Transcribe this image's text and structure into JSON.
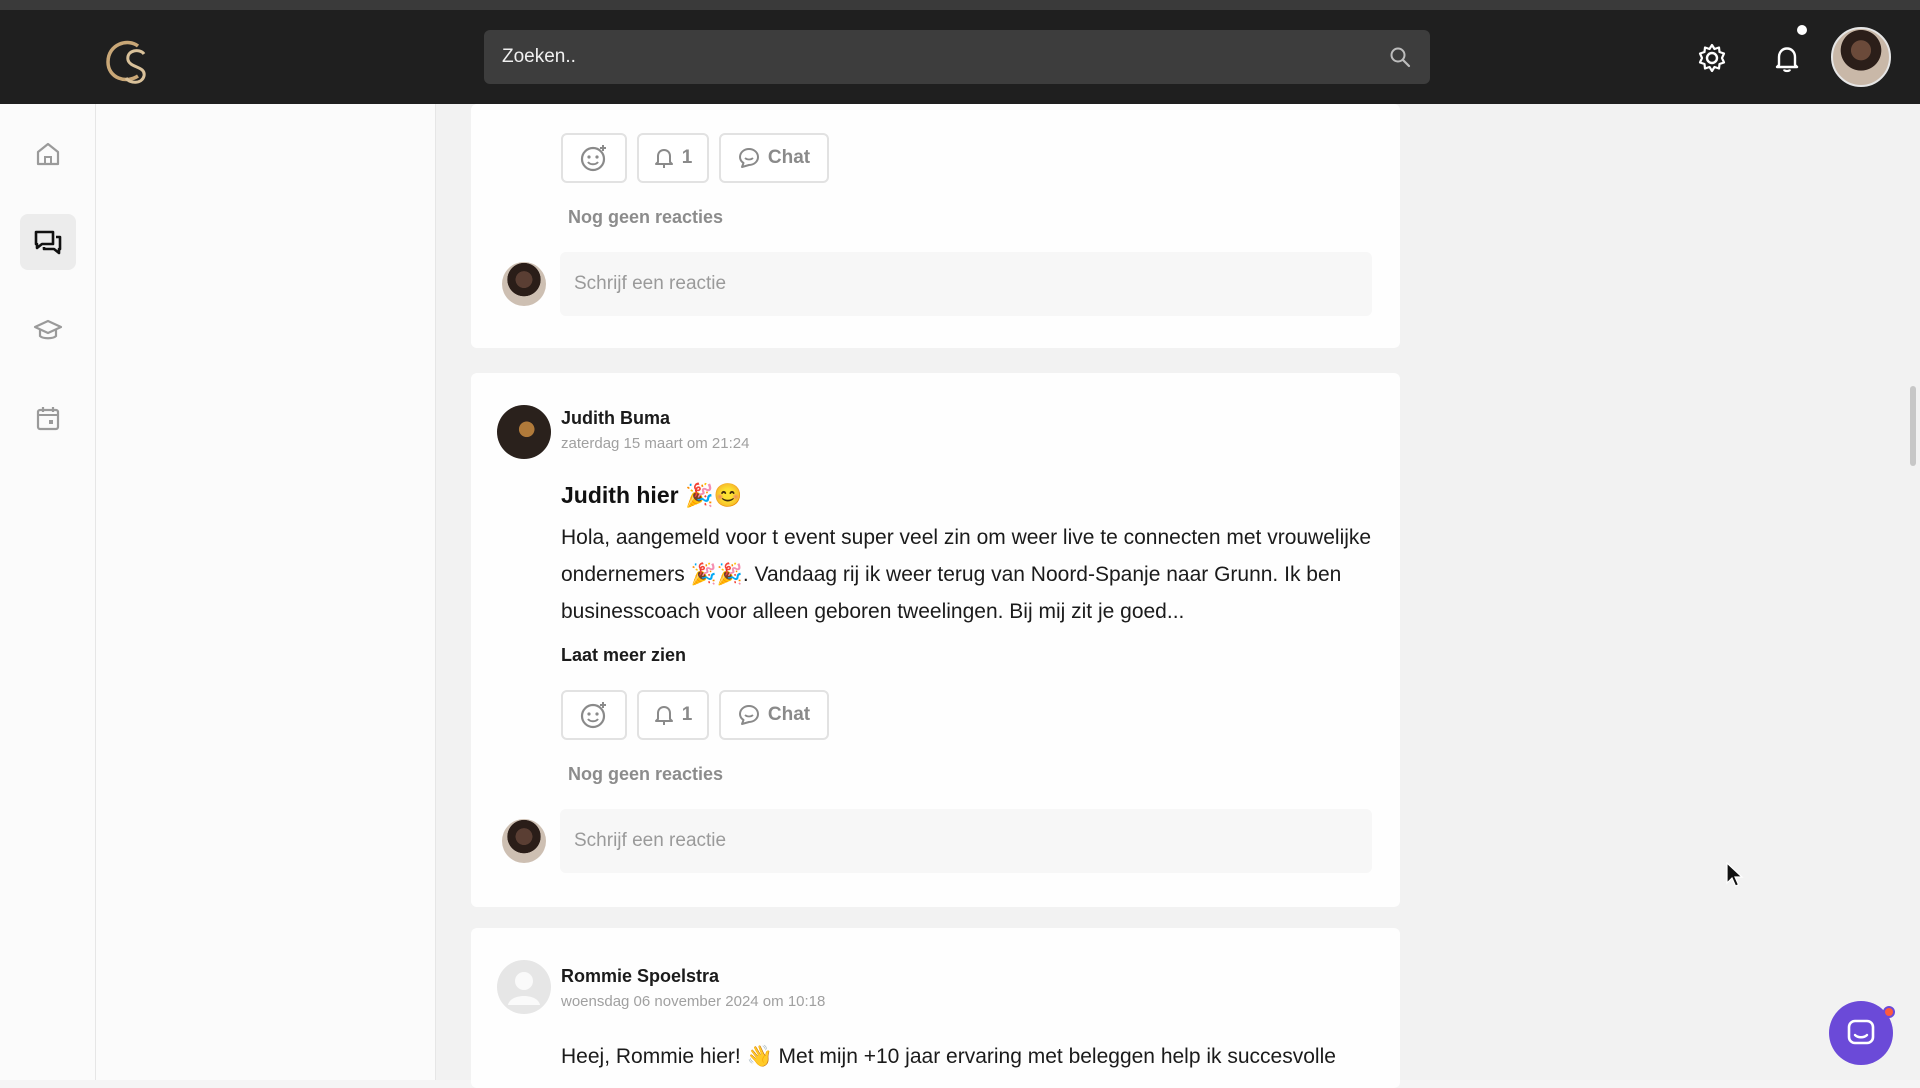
{
  "header": {
    "search_placeholder": "Zoeken..",
    "notification_dot": true
  },
  "colors": {
    "topbar": "#1f1f1f",
    "logo_gold": "#c9a777",
    "chat_fab": "#6b4ad8",
    "fab_badge": "#ff5a3c"
  },
  "nav": {
    "items": [
      {
        "icon": "home-icon"
      },
      {
        "icon": "chat-bubbles-icon",
        "active": true
      },
      {
        "icon": "graduation-cap-icon"
      },
      {
        "icon": "calendar-icon"
      }
    ]
  },
  "posts": [
    {
      "actions": {
        "bell_count": "1",
        "chat_label": "Chat"
      },
      "no_reactions": "Nog geen reacties",
      "reply_placeholder": "Schrijf een reactie"
    },
    {
      "author": "Judith Buma",
      "date": "zaterdag 15 maart om 21:24",
      "title": "Judith hier 🎉😊",
      "body": "Hola, aangemeld voor t event super veel zin om weer live te connecten met vrouwelijke ondernemers 🎉🎉. Vandaag rij ik weer terug van Noord-Spanje naar Grunn. Ik ben businesscoach voor alleen geboren tweelingen. Bij mij zit je goed...",
      "more_label": "Laat meer zien",
      "actions": {
        "bell_count": "1",
        "chat_label": "Chat"
      },
      "no_reactions": "Nog geen reacties",
      "reply_placeholder": "Schrijf een reactie"
    },
    {
      "author": "Rommie Spoelstra",
      "date": "woensdag 06 november 2024 om 10:18",
      "body": "Heej, Rommie hier! 👋 Met mijn +10 jaar ervaring met beleggen help ik succesvolle"
    }
  ]
}
